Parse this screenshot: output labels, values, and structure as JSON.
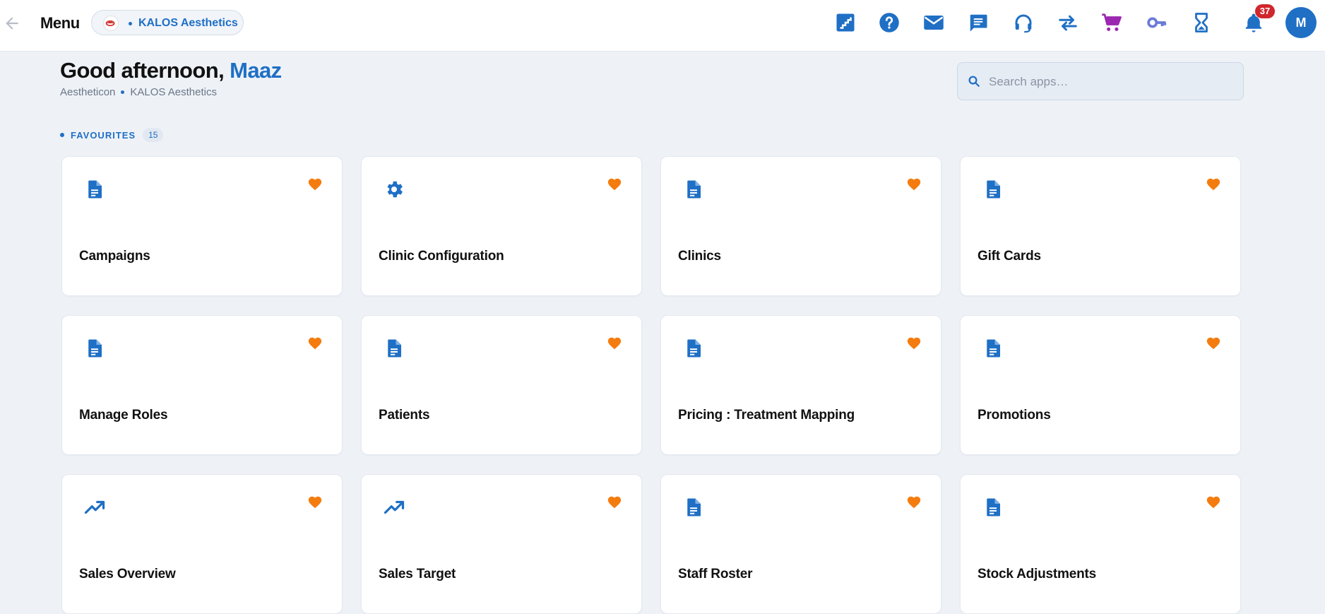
{
  "header": {
    "menu_title": "Menu",
    "org_name": "KALOS Aesthetics",
    "notification_count": "37",
    "avatar_initial": "M",
    "colors": {
      "accent": "#1f6fc5",
      "badge": "#d0262d",
      "cart": "#9c27b0",
      "key": "#6a7bd8"
    },
    "icons": [
      "stairs-icon",
      "help-icon",
      "mail-icon",
      "chat-icon",
      "support-icon",
      "swap-icon",
      "cart-icon",
      "key-icon",
      "hourglass-icon",
      "bell-icon"
    ]
  },
  "greeting": {
    "prefix": "Good afternoon,",
    "name": "Maaz",
    "breadcrumb": [
      "Aestheticon",
      "KALOS Aesthetics"
    ]
  },
  "search": {
    "placeholder": "Search apps…"
  },
  "favourites": {
    "label": "FAVOURITES",
    "count": "15",
    "fav_color": "#f47c0f",
    "cards": [
      {
        "title": "Campaigns",
        "icon": "document-icon"
      },
      {
        "title": "Clinic Configuration",
        "icon": "gear-icon"
      },
      {
        "title": "Clinics",
        "icon": "document-icon"
      },
      {
        "title": "Gift Cards",
        "icon": "document-icon"
      },
      {
        "title": "Manage Roles",
        "icon": "document-icon"
      },
      {
        "title": "Patients",
        "icon": "document-icon"
      },
      {
        "title": "Pricing : Treatment Mapping",
        "icon": "document-icon"
      },
      {
        "title": "Promotions",
        "icon": "document-icon"
      },
      {
        "title": "Sales Overview",
        "icon": "trending-up-icon"
      },
      {
        "title": "Sales Target",
        "icon": "trending-up-icon"
      },
      {
        "title": "Staff Roster",
        "icon": "document-icon"
      },
      {
        "title": "Stock Adjustments",
        "icon": "document-icon"
      }
    ]
  }
}
